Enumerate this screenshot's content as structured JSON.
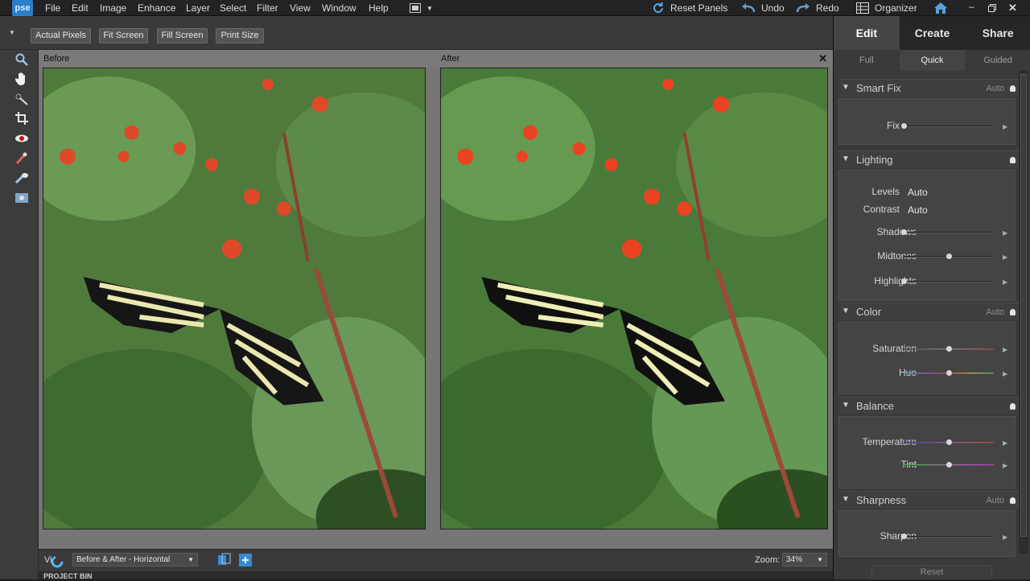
{
  "app": {
    "logo": "pse"
  },
  "menu": [
    "File",
    "Edit",
    "Image",
    "Enhance",
    "Layer",
    "Select",
    "Filter",
    "View",
    "Window",
    "Help"
  ],
  "toolbar": {
    "reset_panels": "Reset Panels",
    "undo": "Undo",
    "redo": "Redo",
    "organizer": "Organizer"
  },
  "options": {
    "actual_pixels": "Actual Pixels",
    "fit_screen": "Fit Screen",
    "fill_screen": "Fill Screen",
    "print_size": "Print Size"
  },
  "panes": {
    "before": "Before",
    "after": "After"
  },
  "status": {
    "view_label": "Vi",
    "view_select": "Before & After - Horizontal",
    "zoom_label": "Zoom:",
    "zoom_value": "34%"
  },
  "project_bin": "PROJECT BIN",
  "mode_tabs": {
    "edit": "Edit",
    "create": "Create",
    "share": "Share"
  },
  "edit_tabs": {
    "full": "Full",
    "quick": "Quick",
    "guided": "Guided"
  },
  "sections": {
    "smart_fix": {
      "title": "Smart Fix",
      "auto": "Auto",
      "fix_label": "Fix",
      "fix_level": 0.0
    },
    "lighting": {
      "title": "Lighting",
      "levels_label": "Levels",
      "levels_value": "Auto",
      "contrast_label": "Contrast",
      "contrast_value": "Auto",
      "shadows_label": "Shadows",
      "shadows_level": 0.0,
      "midtones_label": "Midtones",
      "midtones_level": 0.5,
      "highlights_label": "Highlights",
      "highlights_level": 0.0
    },
    "color": {
      "title": "Color",
      "auto": "Auto",
      "saturation_label": "Saturation",
      "saturation_level": 0.5,
      "hue_label": "Hue",
      "hue_level": 0.5
    },
    "balance": {
      "title": "Balance",
      "temperature_label": "Temperature",
      "temperature_level": 0.5,
      "tint_label": "Tint",
      "tint_level": 0.5
    },
    "sharpness": {
      "title": "Sharpness",
      "auto": "Auto",
      "sharpen_label": "Sharpen",
      "sharpen_level": 0.0
    }
  },
  "reset_label": "Reset",
  "colors": {
    "accent": "#2a7fc9",
    "knob": "#d8d8d8"
  }
}
